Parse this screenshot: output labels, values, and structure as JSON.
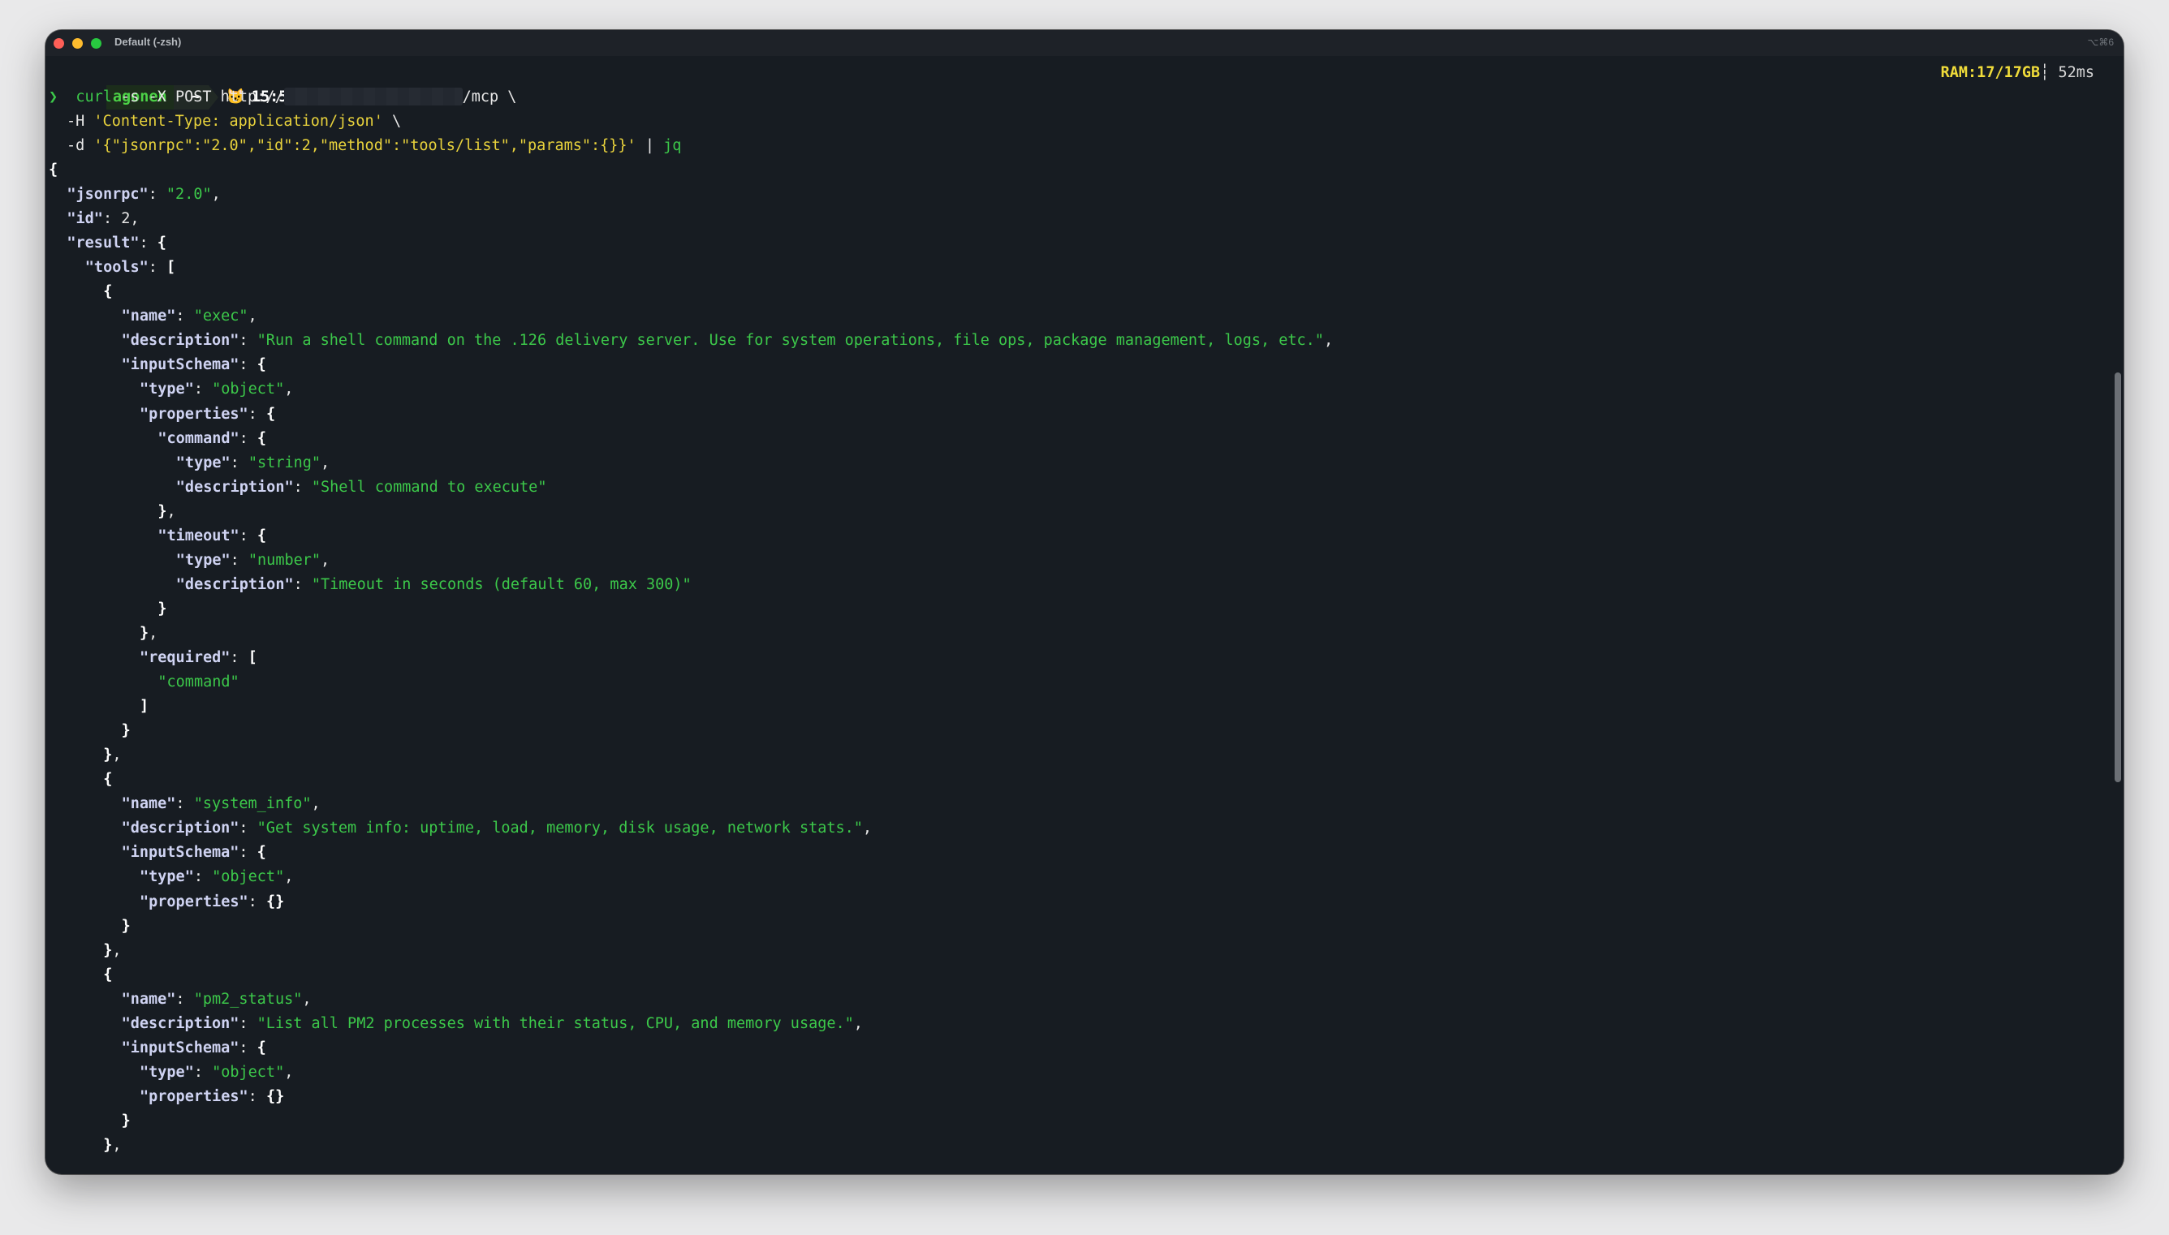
{
  "window": {
    "title": "Default (-zsh)",
    "shortcut": "⌥⌘6"
  },
  "prompt": {
    "user": "agonen",
    "dir": "~",
    "icon": "🐱",
    "time": "15:55",
    "ram": "RAM:17/17GB",
    "separator": "┆",
    "duration": "52ms"
  },
  "command": {
    "chevron": "❯",
    "line1_cmd": "curl",
    "line1_args": " -s -X POST http://",
    "line1_tail": "/mcp \\",
    "line2_flag": "-H ",
    "line2_str": "'Content-Type: application/json'",
    "line2_tail": " \\",
    "line3_flag": "-d ",
    "line3_str": "'{\"jsonrpc\":\"2.0\",\"id\":2,\"method\":\"tools/list\",\"params\":{}}'",
    "line3_pipe": " | ",
    "line3_jq": "jq"
  },
  "output": [
    {
      "i": 0,
      "p": [
        {
          "c": "b",
          "t": "{"
        }
      ]
    },
    {
      "i": 1,
      "p": [
        {
          "c": "k",
          "t": "\"jsonrpc\""
        },
        {
          "c": "w",
          "t": ": "
        },
        {
          "c": "s",
          "t": "\"2.0\""
        },
        {
          "c": "w",
          "t": ","
        }
      ]
    },
    {
      "i": 1,
      "p": [
        {
          "c": "k",
          "t": "\"id\""
        },
        {
          "c": "w",
          "t": ": 2,"
        }
      ]
    },
    {
      "i": 1,
      "p": [
        {
          "c": "k",
          "t": "\"result\""
        },
        {
          "c": "w",
          "t": ": "
        },
        {
          "c": "b",
          "t": "{"
        }
      ]
    },
    {
      "i": 2,
      "p": [
        {
          "c": "k",
          "t": "\"tools\""
        },
        {
          "c": "w",
          "t": ": "
        },
        {
          "c": "b",
          "t": "["
        }
      ]
    },
    {
      "i": 3,
      "p": [
        {
          "c": "b",
          "t": "{"
        }
      ]
    },
    {
      "i": 4,
      "p": [
        {
          "c": "k",
          "t": "\"name\""
        },
        {
          "c": "w",
          "t": ": "
        },
        {
          "c": "s",
          "t": "\"exec\""
        },
        {
          "c": "w",
          "t": ","
        }
      ]
    },
    {
      "i": 4,
      "p": [
        {
          "c": "k",
          "t": "\"description\""
        },
        {
          "c": "w",
          "t": ": "
        },
        {
          "c": "s",
          "t": "\"Run a shell command on the .126 delivery server. Use for system operations, file ops, package management, logs, etc.\""
        },
        {
          "c": "w",
          "t": ","
        }
      ]
    },
    {
      "i": 4,
      "p": [
        {
          "c": "k",
          "t": "\"inputSchema\""
        },
        {
          "c": "w",
          "t": ": "
        },
        {
          "c": "b",
          "t": "{"
        }
      ]
    },
    {
      "i": 5,
      "p": [
        {
          "c": "k",
          "t": "\"type\""
        },
        {
          "c": "w",
          "t": ": "
        },
        {
          "c": "s",
          "t": "\"object\""
        },
        {
          "c": "w",
          "t": ","
        }
      ]
    },
    {
      "i": 5,
      "p": [
        {
          "c": "k",
          "t": "\"properties\""
        },
        {
          "c": "w",
          "t": ": "
        },
        {
          "c": "b",
          "t": "{"
        }
      ]
    },
    {
      "i": 6,
      "p": [
        {
          "c": "k",
          "t": "\"command\""
        },
        {
          "c": "w",
          "t": ": "
        },
        {
          "c": "b",
          "t": "{"
        }
      ]
    },
    {
      "i": 7,
      "p": [
        {
          "c": "k",
          "t": "\"type\""
        },
        {
          "c": "w",
          "t": ": "
        },
        {
          "c": "s",
          "t": "\"string\""
        },
        {
          "c": "w",
          "t": ","
        }
      ]
    },
    {
      "i": 7,
      "p": [
        {
          "c": "k",
          "t": "\"description\""
        },
        {
          "c": "w",
          "t": ": "
        },
        {
          "c": "s",
          "t": "\"Shell command to execute\""
        }
      ]
    },
    {
      "i": 6,
      "p": [
        {
          "c": "b",
          "t": "}"
        },
        {
          "c": "w",
          "t": ","
        }
      ]
    },
    {
      "i": 6,
      "p": [
        {
          "c": "k",
          "t": "\"timeout\""
        },
        {
          "c": "w",
          "t": ": "
        },
        {
          "c": "b",
          "t": "{"
        }
      ]
    },
    {
      "i": 7,
      "p": [
        {
          "c": "k",
          "t": "\"type\""
        },
        {
          "c": "w",
          "t": ": "
        },
        {
          "c": "s",
          "t": "\"number\""
        },
        {
          "c": "w",
          "t": ","
        }
      ]
    },
    {
      "i": 7,
      "p": [
        {
          "c": "k",
          "t": "\"description\""
        },
        {
          "c": "w",
          "t": ": "
        },
        {
          "c": "s",
          "t": "\"Timeout in seconds (default 60, max 300)\""
        }
      ]
    },
    {
      "i": 6,
      "p": [
        {
          "c": "b",
          "t": "}"
        }
      ]
    },
    {
      "i": 5,
      "p": [
        {
          "c": "b",
          "t": "}"
        },
        {
          "c": "w",
          "t": ","
        }
      ]
    },
    {
      "i": 5,
      "p": [
        {
          "c": "k",
          "t": "\"required\""
        },
        {
          "c": "w",
          "t": ": "
        },
        {
          "c": "b",
          "t": "["
        }
      ]
    },
    {
      "i": 6,
      "p": [
        {
          "c": "s",
          "t": "\"command\""
        }
      ]
    },
    {
      "i": 5,
      "p": [
        {
          "c": "b",
          "t": "]"
        }
      ]
    },
    {
      "i": 4,
      "p": [
        {
          "c": "b",
          "t": "}"
        }
      ]
    },
    {
      "i": 3,
      "p": [
        {
          "c": "b",
          "t": "}"
        },
        {
          "c": "w",
          "t": ","
        }
      ]
    },
    {
      "i": 3,
      "p": [
        {
          "c": "b",
          "t": "{"
        }
      ]
    },
    {
      "i": 4,
      "p": [
        {
          "c": "k",
          "t": "\"name\""
        },
        {
          "c": "w",
          "t": ": "
        },
        {
          "c": "s",
          "t": "\"system_info\""
        },
        {
          "c": "w",
          "t": ","
        }
      ]
    },
    {
      "i": 4,
      "p": [
        {
          "c": "k",
          "t": "\"description\""
        },
        {
          "c": "w",
          "t": ": "
        },
        {
          "c": "s",
          "t": "\"Get system info: uptime, load, memory, disk usage, network stats.\""
        },
        {
          "c": "w",
          "t": ","
        }
      ]
    },
    {
      "i": 4,
      "p": [
        {
          "c": "k",
          "t": "\"inputSchema\""
        },
        {
          "c": "w",
          "t": ": "
        },
        {
          "c": "b",
          "t": "{"
        }
      ]
    },
    {
      "i": 5,
      "p": [
        {
          "c": "k",
          "t": "\"type\""
        },
        {
          "c": "w",
          "t": ": "
        },
        {
          "c": "s",
          "t": "\"object\""
        },
        {
          "c": "w",
          "t": ","
        }
      ]
    },
    {
      "i": 5,
      "p": [
        {
          "c": "k",
          "t": "\"properties\""
        },
        {
          "c": "w",
          "t": ": "
        },
        {
          "c": "b",
          "t": "{}"
        }
      ]
    },
    {
      "i": 4,
      "p": [
        {
          "c": "b",
          "t": "}"
        }
      ]
    },
    {
      "i": 3,
      "p": [
        {
          "c": "b",
          "t": "}"
        },
        {
          "c": "w",
          "t": ","
        }
      ]
    },
    {
      "i": 3,
      "p": [
        {
          "c": "b",
          "t": "{"
        }
      ]
    },
    {
      "i": 4,
      "p": [
        {
          "c": "k",
          "t": "\"name\""
        },
        {
          "c": "w",
          "t": ": "
        },
        {
          "c": "s",
          "t": "\"pm2_status\""
        },
        {
          "c": "w",
          "t": ","
        }
      ]
    },
    {
      "i": 4,
      "p": [
        {
          "c": "k",
          "t": "\"description\""
        },
        {
          "c": "w",
          "t": ": "
        },
        {
          "c": "s",
          "t": "\"List all PM2 processes with their status, CPU, and memory usage.\""
        },
        {
          "c": "w",
          "t": ","
        }
      ]
    },
    {
      "i": 4,
      "p": [
        {
          "c": "k",
          "t": "\"inputSchema\""
        },
        {
          "c": "w",
          "t": ": "
        },
        {
          "c": "b",
          "t": "{"
        }
      ]
    },
    {
      "i": 5,
      "p": [
        {
          "c": "k",
          "t": "\"type\""
        },
        {
          "c": "w",
          "t": ": "
        },
        {
          "c": "s",
          "t": "\"object\""
        },
        {
          "c": "w",
          "t": ","
        }
      ]
    },
    {
      "i": 5,
      "p": [
        {
          "c": "k",
          "t": "\"properties\""
        },
        {
          "c": "w",
          "t": ": "
        },
        {
          "c": "b",
          "t": "{}"
        }
      ]
    },
    {
      "i": 4,
      "p": [
        {
          "c": "b",
          "t": "}"
        }
      ]
    },
    {
      "i": 3,
      "p": [
        {
          "c": "b",
          "t": "}"
        },
        {
          "c": "w",
          "t": ","
        }
      ]
    }
  ],
  "colors": {
    "background": "#171c22",
    "key": "#cfd3f2",
    "string": "#3cc84a",
    "ram": "#f0dc3a",
    "prompt_user": "#4cd247"
  }
}
